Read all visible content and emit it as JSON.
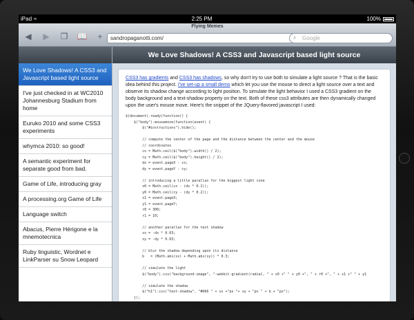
{
  "status": {
    "carrier": "iPad",
    "time": "2:25 PM",
    "battery": "100%"
  },
  "browser": {
    "page_title": "Flying Memes",
    "url": "sandropaganotti.com/",
    "search_placeholder": "Google",
    "icons": [
      "back-icon",
      "forward-icon",
      "tabs-icon",
      "bookmarks-icon",
      "add-icon",
      "reload-icon",
      "search-icon"
    ]
  },
  "sidebar": {
    "items": [
      "We Love Shadows! A CSS3 and Javascript based light source",
      "I've just checked in at WC2010 Johannesburg Stadium from home",
      "Euruko 2010 and some CSS3 experiments",
      "whymca 2010: so good!",
      "A semantic experiment for separate good from bad.",
      "Game of Life, introducing gray",
      "A processing.org Game of Life",
      "Language switch",
      "Abacus, Pierre Hérigone e la mnemotecnica",
      "Ruby linguistic, Wordnet e LinkParser su Snow Leopard"
    ]
  },
  "article": {
    "title": "We Love Shadows! A CSS3 and Javascript based light source",
    "link1": "CSS3 has gradients",
    "t1": " and ",
    "link2": "CSS3 has shadows",
    "t2": ", so why don't try to use both to simulate a light source ? That is the basic idea behind this project. ",
    "link3": "I've set-up a small demo",
    "t3": " which let you use the mouse to direct a light source over a text and observe its shadow change according to light position. To simulate the light behavior I used a CSS3 gradient on the body background and a text-shadow property on the text. Both of these css3 attributes are then dynamically changed upon the user's mouse move. Here's the snippet of the JQuery-flavored javascript I used:",
    "code": "$(document).ready(function() {\n    $(\"body\").mousemove(function(event) {\n        $(\"#instructions\").hide();\n\n        // compute the center of the page and the distance between the center and the mouse\n        // coordinates\n        cx = Math.ceil($(\"body\").width() / 2);\n        cy = Math.ceil($(\"body\").height() / 2);\n        dx = event.pageX - cx;\n        dy = event.pageY - cy;\n\n        // introducing a little parallax for the biggest light cone\n        x0 = Math.ceil(cx - (dx * 0.2));\n        y0 = Math.ceil(cy - (dy * 0.2));\n        x1 = event.pageX;\n        y1 = event.pageY;\n        r0 = 300;\n        r1 = 10;\n\n        // another parallax for the text shadow\n        sx = -dx * 0.03;\n        sy = -dy * 0.03;\n\n        // blur the shadow depending upon its distance\n        b   = (Math.abs(sx) + Math.abs(sy)) * 0.3;\n\n        // simulate the light\n        $(\"body\").css(\"background-image\", \"-webkit-gradient(radial, \" + x0 +\" \" + y0 +\", \" + r0 +\", \" + x1 +\" \" + y1\n\n        // simulate the shadow\n        $(\"h1\").css(\"text-shadow\", \"#666 \" + sx +\"px \"+ sy + \"px \" + b + \"px\");\n    });"
  }
}
